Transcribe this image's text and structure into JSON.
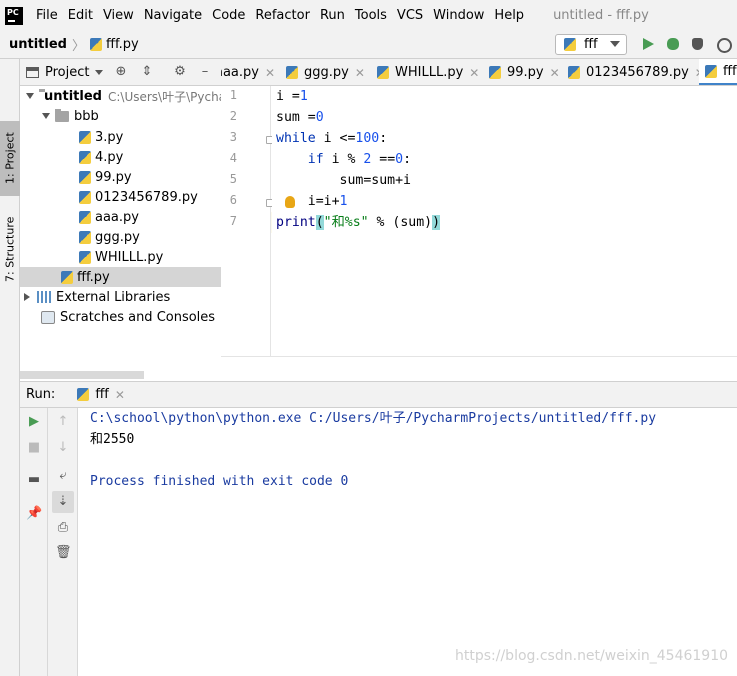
{
  "menubar": {
    "logo": "PC",
    "items": [
      "File",
      "Edit",
      "View",
      "Navigate",
      "Code",
      "Refactor",
      "Run",
      "Tools",
      "VCS",
      "Window",
      "Help"
    ],
    "window_title": "untitled - fff.py"
  },
  "navbar": {
    "root": "untitled",
    "file": "fff.py",
    "run_config": "fff"
  },
  "sidebar": {
    "project_tab": "1: Project",
    "structure_tab": "7: Structure"
  },
  "project": {
    "title": "Project",
    "tree": [
      {
        "label": "untitled",
        "path": "C:\\Users\\叶子\\PycharmProjects\\untitled",
        "kind": "folder"
      },
      {
        "label": "bbb",
        "kind": "folder"
      },
      {
        "label": "3.py",
        "kind": "file"
      },
      {
        "label": "4.py",
        "kind": "file"
      },
      {
        "label": "99.py",
        "kind": "file"
      },
      {
        "label": "0123456789.py",
        "kind": "file"
      },
      {
        "label": "aaa.py",
        "kind": "file"
      },
      {
        "label": "ggg.py",
        "kind": "file"
      },
      {
        "label": "WHILLL.py",
        "kind": "file"
      },
      {
        "label": "fff.py",
        "kind": "file",
        "selected": true
      },
      {
        "label": "External Libraries",
        "kind": "library"
      },
      {
        "label": "Scratches and Consoles",
        "kind": "scratch"
      }
    ]
  },
  "editor": {
    "tabs": [
      "aaa.py",
      "ggg.py",
      "WHILLL.py",
      "99.py",
      "0123456789.py",
      "fff.py"
    ],
    "active_tab": "fff.py",
    "line_numbers": [
      "1",
      "2",
      "3",
      "4",
      "5",
      "6",
      "7"
    ]
  },
  "run": {
    "label": "Run:",
    "tab": "fff",
    "console": [
      "C:\\school\\python\\python.exe C:/Users/叶子/PycharmProjects/untitled/fff.py",
      "和2550",
      "",
      "Process finished with exit code 0"
    ]
  },
  "watermark": "https://blog.csdn.net/weixin_45461910",
  "colors": {
    "accent": "#4083c9",
    "run_green": "#499c54",
    "console_blue": "#1a3ba0"
  }
}
